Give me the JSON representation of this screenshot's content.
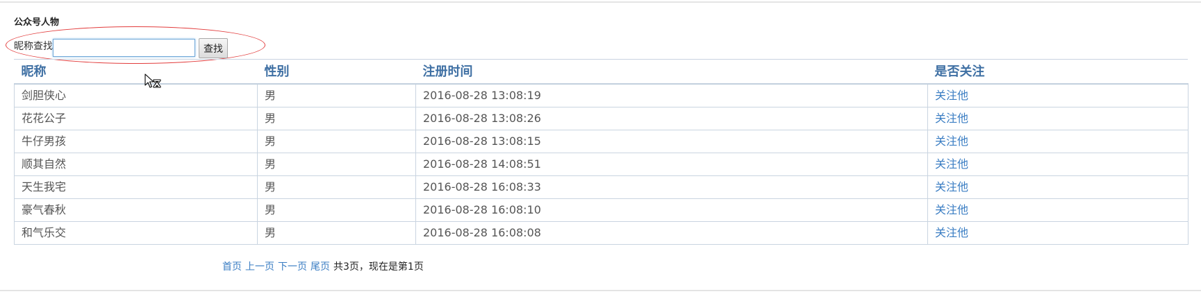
{
  "section": {
    "title": "公众号人物"
  },
  "search": {
    "label": "昵称查找",
    "value": "",
    "placeholder": "",
    "button_label": "查找"
  },
  "table": {
    "headers": [
      "昵称",
      "性别",
      "注册时间",
      "是否关注"
    ],
    "rows": [
      [
        "剑胆侠心",
        "男",
        "2016-08-28 13:08:19",
        "关注他"
      ],
      [
        "花花公子",
        "男",
        "2016-08-28 13:08:26",
        "关注他"
      ],
      [
        "牛仔男孩",
        "男",
        "2016-08-28 13:08:15",
        "关注他"
      ],
      [
        "顺其自然",
        "男",
        "2016-08-28 14:08:51",
        "关注他"
      ],
      [
        "天生我宅",
        "男",
        "2016-08-28 16:08:33",
        "关注他"
      ],
      [
        "豪气春秋",
        "男",
        "2016-08-28 16:08:10",
        "关注他"
      ],
      [
        "和气乐交",
        "男",
        "2016-08-28 16:08:08",
        "关注他"
      ]
    ]
  },
  "pagination": {
    "first": "首页",
    "prev": "上一页",
    "next": "下一页",
    "last": "尾页",
    "summary": "共3页，现在是第1页"
  },
  "colors": {
    "header_text": "#3e6fa3",
    "link": "#3a7dc3",
    "annotation": "#e23b3b"
  },
  "icons": {
    "cursor": "mouse-cursor-busy-icon"
  }
}
